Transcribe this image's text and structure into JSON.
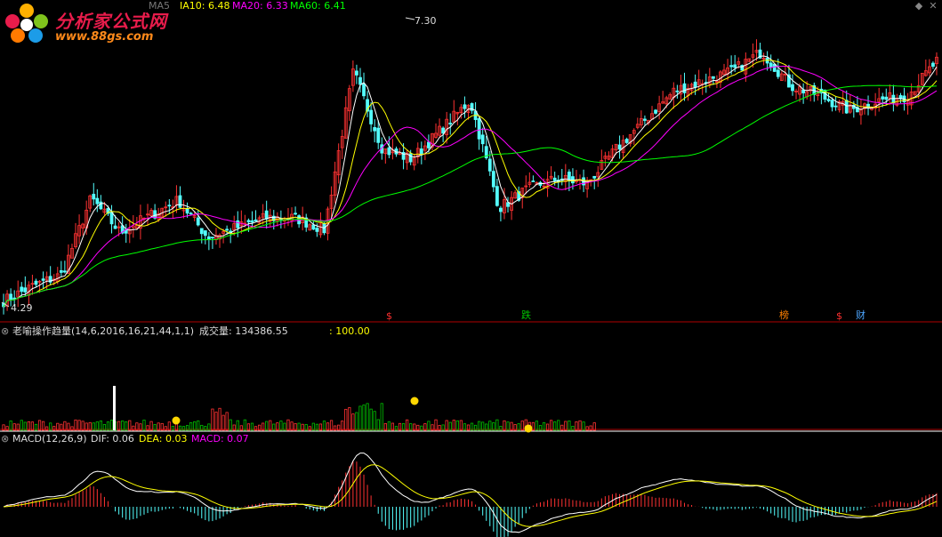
{
  "header": {
    "ma10_label": "IA10: 6.48",
    "ma20_label": "MA20: 6.33",
    "ma60_label": "MA60: 6.41",
    "ma5_fragment": "MA5"
  },
  "logo": {
    "title": "分析家公式网",
    "url": "www.88gs.com"
  },
  "price_panel": {
    "high_label": "7.30",
    "low_label": "4.29",
    "markers": [
      {
        "text": "$",
        "color": "#ff3030"
      },
      {
        "text": "跌",
        "color": "#00c000"
      },
      {
        "text": "榜",
        "color": "#ff8000"
      },
      {
        "text": "$",
        "color": "#ff3030"
      },
      {
        "text": "财",
        "color": "#4da6ff"
      }
    ]
  },
  "volume_panel": {
    "title": "老喻操作趋量(14,6,2016,16,21,44,1,1)",
    "vol_label": "成交量: 134386.55",
    "ref_label": ": 100.00"
  },
  "macd_panel": {
    "title": "MACD(12,26,9)",
    "dif_label": "DIF: 0.06",
    "dea_label": "DEA: 0.03",
    "macd_label": "MACD: 0.07"
  },
  "colors": {
    "up": "#ff3232",
    "down": "#54ffff",
    "ma5": "#ffffff",
    "ma10": "#ffff00",
    "ma20": "#ff00ff",
    "ma60": "#00ff00",
    "separator": "#b00000",
    "dot": "#ffd700"
  },
  "chart_data": {
    "type": "candlestick",
    "price_range": [
      4.29,
      7.3
    ],
    "close_anchors": [
      4.35,
      4.5,
      4.62,
      5.4,
      5.05,
      5.22,
      5.38,
      5.0,
      5.1,
      5.2,
      5.2,
      5.08,
      6.7,
      5.9,
      5.8,
      6.1,
      6.4,
      5.3,
      5.5,
      5.6,
      5.55,
      5.9,
      6.2,
      6.5,
      6.6,
      6.7,
      6.9,
      6.55,
      6.45,
      6.3,
      6.4,
      6.45,
      6.8
    ]
  }
}
